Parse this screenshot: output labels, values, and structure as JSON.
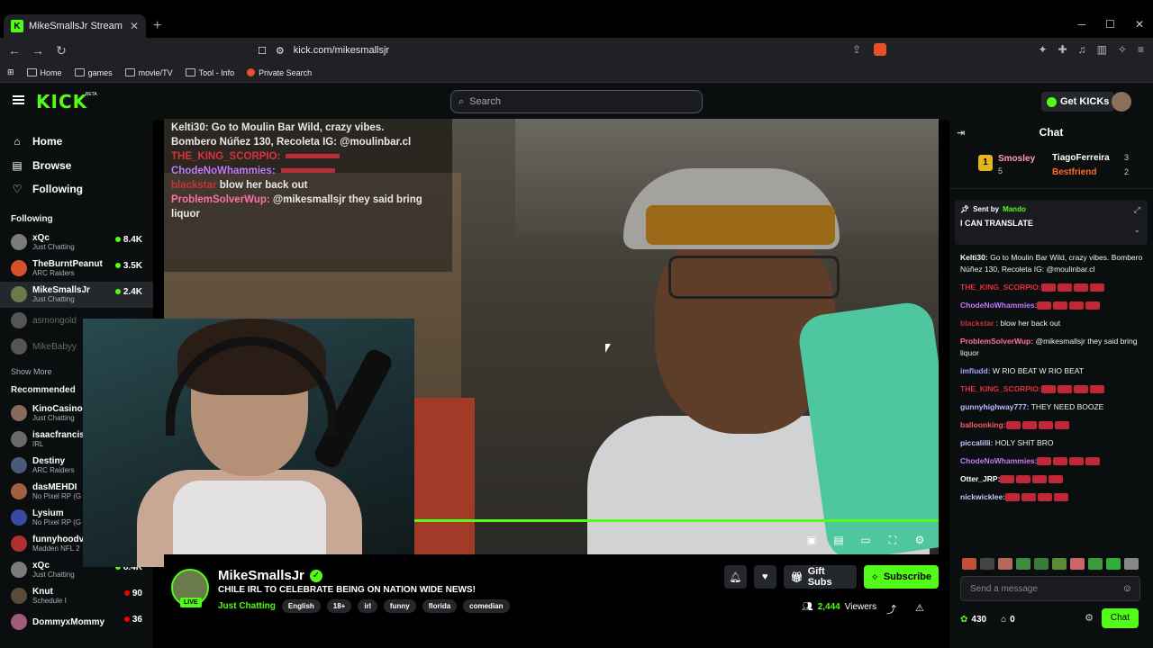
{
  "browser": {
    "tab_title": "MikeSmallsJr Stream - Watch",
    "url": "kick.com/mikesmallsjr",
    "bookmarks": [
      "Home",
      "games",
      "movie/TV",
      "Tool - Info",
      "Private Search"
    ]
  },
  "header": {
    "logo": "KICK",
    "beta": "BETA",
    "search_placeholder": "Search",
    "get_kicks": "Get KICKs"
  },
  "sidebar": {
    "nav": [
      {
        "label": "Home",
        "icon": "home-icon"
      },
      {
        "label": "Browse",
        "icon": "browse-icon"
      },
      {
        "label": "Following",
        "icon": "heart-icon"
      }
    ],
    "following_title": "Following",
    "following": [
      {
        "name": "xQc",
        "category": "Just Chatting",
        "viewers": "8.4K",
        "color": "#7a7a7a"
      },
      {
        "name": "TheBurntPeanut",
        "category": "ARC Raiders",
        "viewers": "3.5K",
        "color": "#d8502a"
      },
      {
        "name": "MikeSmallsJr",
        "category": "Just Chatting",
        "viewers": "2.4K",
        "color": "#6a7a4a"
      },
      {
        "name": "asmongold",
        "category": "",
        "viewers": "",
        "color": "#555"
      },
      {
        "name": "MikeBabyy",
        "category": "",
        "viewers": "",
        "color": "#555"
      }
    ],
    "show_more": "Show More",
    "recommended_title": "Recommended",
    "recommended": [
      {
        "name": "KinoCasinoO",
        "category": "Just Chatting",
        "viewers": "",
        "color": "#8a6a5a"
      },
      {
        "name": "isaacfrancis",
        "category": "IRL",
        "viewers": "",
        "color": "#6a6a6a"
      },
      {
        "name": "Destiny",
        "category": "ARC Raiders",
        "viewers": "",
        "color": "#4a5a7a"
      },
      {
        "name": "dasMEHDI",
        "category": "No Pixel RP (G",
        "viewers": "",
        "color": "#a06040"
      },
      {
        "name": "Lysium",
        "category": "No Pixel RP (G",
        "viewers": "",
        "color": "#3a4aa0"
      },
      {
        "name": "funnyhoodvi",
        "category": "Madden NFL 2",
        "viewers": "",
        "color": "#b03030"
      },
      {
        "name": "xQc",
        "category": "Just Chatting",
        "viewers": "8.4K",
        "color": "#7a7a7a"
      },
      {
        "name": "Knut",
        "category": "Schedule I",
        "viewers": "90",
        "color": "#5a4a3a"
      },
      {
        "name": "DommyxMommy",
        "category": "",
        "viewers": "36",
        "color": "#a05a7a"
      }
    ]
  },
  "video_overlay": [
    {
      "user": "Kelti30:",
      "text": "Go to Moulin Bar Wild, crazy vibes.",
      "color": "#ffffff"
    },
    {
      "user": "",
      "text": "Bombero Núñez 130, Recoleta IG: @moulinbar.cl",
      "color": "#ffffff"
    },
    {
      "user": "THE_KING_SCORPIO:",
      "text": "",
      "color": "#e0303c"
    },
    {
      "user": "ChodeNoWhammies:",
      "text": "",
      "color": "#c47bff"
    },
    {
      "user": "blackstar",
      "text": "blow her back out",
      "color": "#c8323a"
    },
    {
      "user": "ProblemSolverWup:",
      "text": "@mikesmallsjr they said bring liquor",
      "color": "#ff70a6"
    }
  ],
  "stream": {
    "streamer": "MikeSmallsJr",
    "live": "LIVE",
    "title": "CHILE IRL TO CELEBRATE BEING ON NATION WIDE NEWS!",
    "category": "Just Chatting",
    "tags": [
      "English",
      "18+",
      "irl",
      "funny",
      "florida",
      "comedian"
    ],
    "viewers": "2,444",
    "viewers_label": "Viewers",
    "gift_subs": "Gift Subs",
    "subscribe": "Subscribe"
  },
  "chat": {
    "title": "Chat",
    "leaderboard": [
      {
        "name": "Smosley",
        "count": "5",
        "color": "#ff9ea8"
      },
      {
        "name": "TiagoFerreira",
        "count": "3",
        "color": "#ffffff"
      },
      {
        "name": "Bestfriend",
        "count": "2",
        "color": "#ff6a2a"
      }
    ],
    "pinned_sent_by": "Sent by",
    "pinned_user": "Mando",
    "pinned_text": "I CAN TRANSLATE",
    "messages": [
      {
        "user": "Kelti30:",
        "text": "Go to Moulin Bar Wild, crazy vibes. Bombero Núñez 130, Recoleta IG: @moulinbar.cl",
        "color": "#ffffff"
      },
      {
        "user": "THE_KING_SCORPIO:",
        "text": "",
        "color": "#e0303c"
      },
      {
        "user": "ChodeNoWhammies:",
        "text": "",
        "color": "#c47bff"
      },
      {
        "user": "blackstar",
        "text": ": blow her back out",
        "color": "#c8323a"
      },
      {
        "user": "ProblemSolverWup:",
        "text": "@mikesmallsjr they said bring liquor",
        "color": "#ff70a6"
      },
      {
        "user": "imfludd:",
        "text": "W RIO BEAT W RIO BEAT",
        "color": "#a7a0ff"
      },
      {
        "user": "THE_KING_SCORPIO:",
        "text": "",
        "color": "#e0303c"
      },
      {
        "user": "gunnyhighway777:",
        "text": "THEY NEED BOOZE",
        "color": "#c4b5ff"
      },
      {
        "user": "balloonking:",
        "text": "",
        "color": "#ff5a6a"
      },
      {
        "user": "piccalilli:",
        "text": "HOLY SHIT BRO",
        "color": "#c6c6ff"
      },
      {
        "user": "ChodeNoWhammies:",
        "text": "",
        "color": "#c47bff"
      },
      {
        "user": "Otter_JRP:",
        "text": "",
        "color": "#ffffff"
      },
      {
        "user": "nickwicklee:",
        "text": "",
        "color": "#c6c6ff"
      }
    ],
    "input_placeholder": "Send a message",
    "points": "430",
    "store_count": "0",
    "chat_button": "Chat"
  }
}
